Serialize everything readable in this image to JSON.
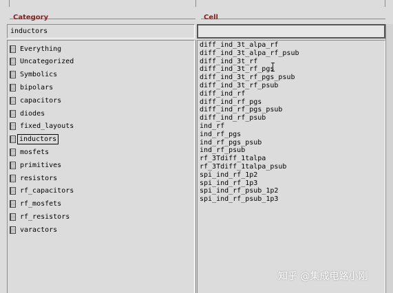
{
  "category": {
    "header": "Category",
    "filter_value": "inductors",
    "items": [
      {
        "label": "Everything"
      },
      {
        "label": "Uncategorized"
      },
      {
        "label": "Symbolics"
      },
      {
        "label": "bipolars"
      },
      {
        "label": "capacitors"
      },
      {
        "label": "diodes"
      },
      {
        "label": "fixed_layouts"
      },
      {
        "label": "inductors",
        "selected": true
      },
      {
        "label": "mosfets"
      },
      {
        "label": "primitives"
      },
      {
        "label": "resistors"
      },
      {
        "label": "rf_capacitors"
      },
      {
        "label": "rf_mosfets"
      },
      {
        "label": "rf_resistors"
      },
      {
        "label": "varactors"
      }
    ]
  },
  "cell": {
    "header": "Cell",
    "filter_value": "",
    "items": [
      "diff_ind_3t_alpa_rf",
      "diff_ind_3t_alpa_rf_psub",
      "diff_ind_3t_rf",
      "diff_ind_3t_rf_pgs",
      "diff_ind_3t_rf_pgs_psub",
      "diff_ind_3t_rf_psub",
      "diff_ind_rf",
      "diff_ind_rf_pgs",
      "diff_ind_rf_pgs_psub",
      "diff_ind_rf_psub",
      "ind_rf",
      "ind_rf_pgs",
      "ind_rf_pgs_psub",
      "ind_rf_psub",
      "rf_3Tdiff_1talpa",
      "rf_3Tdiff_1talpa_psub",
      "spi_ind_rf_1p2",
      "spi_ind_rf_1p3",
      "spi_ind_rf_psub_1p2",
      "spi_ind_rf_psub_1p3"
    ]
  },
  "watermark": "知乎 @集成电路小刚",
  "colors": {
    "header_text": "#8b1e1e",
    "background": "#dcdcdc"
  }
}
